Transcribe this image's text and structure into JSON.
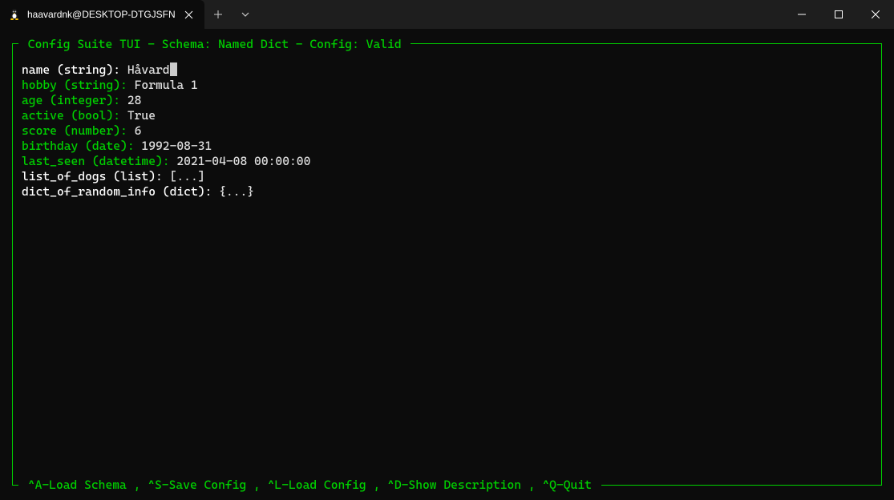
{
  "titlebar": {
    "tab_title": "haavardnk@DESKTOP-DTGJSFN"
  },
  "tui": {
    "header": " Config Suite TUI - Schema: Named Dict - Config: Valid ",
    "footer": " ^A-Load Schema , ^S-Save Config , ^L-Load Config , ^D-Show Description , ^Q-Quit "
  },
  "fields": {
    "name": {
      "label": "name (string): ",
      "value": "Håvard"
    },
    "hobby": {
      "label": "hobby (string): ",
      "value": "Formula 1"
    },
    "age": {
      "label": "age (integer): ",
      "value": "28"
    },
    "active": {
      "label": "active (bool): ",
      "value": "True"
    },
    "score": {
      "label": "score (number): ",
      "value": "6"
    },
    "birthday": {
      "label": "birthday (date): ",
      "value": "1992-08-31"
    },
    "last_seen": {
      "label": "last_seen (datetime): ",
      "value": "2021-04-08 00:00:00"
    },
    "list_of_dogs": {
      "label": "list_of_dogs (list): ",
      "value": "[...]"
    },
    "dict_of_random_info": {
      "label": "dict_of_random_info (dict): ",
      "value": "{...}"
    }
  }
}
